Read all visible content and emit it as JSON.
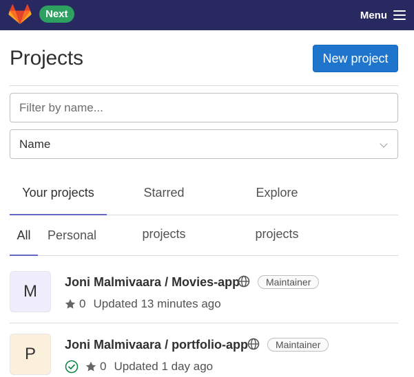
{
  "header": {
    "logo_icon": "gitlab-tanuki-icon",
    "next_badge": "Next",
    "menu_label": "Menu",
    "menu_icon": "hamburger-icon",
    "bar_color": "#292961"
  },
  "page": {
    "title": "Projects",
    "new_project_label": "New project"
  },
  "filter": {
    "placeholder": "Filter by name...",
    "value": ""
  },
  "sort": {
    "selected": "Name"
  },
  "tabs": [
    {
      "label": "Your projects",
      "active": true
    },
    {
      "label": "Starred projects",
      "active": false
    },
    {
      "label": "Explore projects",
      "active": false
    }
  ],
  "subtabs": [
    {
      "label": "All",
      "active": true
    },
    {
      "label": "Personal",
      "active": false
    }
  ],
  "projects": [
    {
      "avatar_letter": "M",
      "name": "Joni Malmivaara / Movies-app",
      "visibility_icon": "globe-icon",
      "role": "Maintainer",
      "pipeline_status": null,
      "stars": "0",
      "updated": "Updated 13 minutes ago"
    },
    {
      "avatar_letter": "P",
      "name": "Joni Malmivaara / portfolio-app",
      "visibility_icon": "globe-icon",
      "role": "Maintainer",
      "pipeline_status": "success-check-icon",
      "stars": "0",
      "updated": "Updated 1 day ago"
    }
  ],
  "colors": {
    "accent": "#1f75cb",
    "tab_underline": "#6666c4",
    "badge_green": "#2da160",
    "success": "#108548"
  }
}
